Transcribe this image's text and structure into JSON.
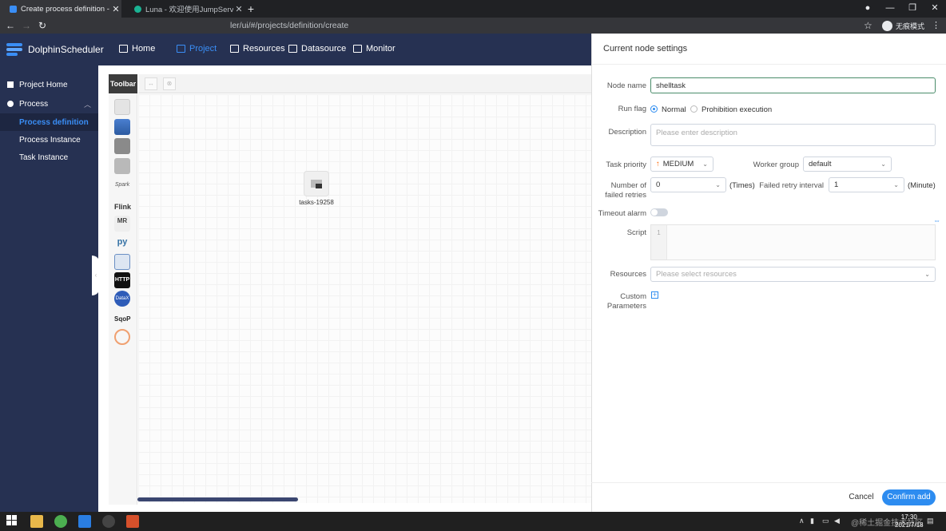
{
  "browser": {
    "tabs": [
      {
        "title": "Create process definition - Do",
        "active": true
      },
      {
        "title": "Luna - 欢迎使用JumpServer开源",
        "active": false
      }
    ],
    "url": "ler/ui/#/projects/definition/create",
    "profile": "无痕模式"
  },
  "app": {
    "brand": "DolphinScheduler",
    "nav": [
      {
        "label": "Home",
        "icon": "home-icon"
      },
      {
        "label": "Project",
        "icon": "project-icon",
        "active": true
      },
      {
        "label": "Resources",
        "icon": "folder-icon"
      },
      {
        "label": "Datasource",
        "icon": "database-icon"
      },
      {
        "label": "Monitor",
        "icon": "monitor-icon"
      }
    ],
    "accent": "#3a8ef6",
    "header_bg": "#263152"
  },
  "sidebar": {
    "items": [
      {
        "label": "Project Home",
        "icon": "home-icon"
      },
      {
        "label": "Process",
        "icon": "gear-icon",
        "expandable": true
      },
      {
        "label": "Process definition",
        "active": true
      },
      {
        "label": "Process Instance"
      },
      {
        "label": "Task Instance"
      }
    ]
  },
  "canvas": {
    "toolbar_label": "Toolbar",
    "tools": [
      "shell-icon",
      "sub-process-icon",
      "procedure-icon",
      "sql-icon",
      "spark-icon",
      "flink-icon",
      "mr-icon",
      "python-icon",
      "dependent-icon",
      "http-icon",
      "datax-icon",
      "sqoop-icon",
      "conditions-icon"
    ],
    "flink_label": "Flink",
    "mr_label": "MR",
    "python_label": "py",
    "http_label": "HTTP",
    "datax_label": "DataX",
    "sqoop_label": "SqoP",
    "spark_label": "Spark",
    "node_label": "tasks-19258"
  },
  "drawer": {
    "title": "Current node settings",
    "node_name": {
      "label": "Node name",
      "value": "shelltask"
    },
    "run_flag": {
      "label": "Run flag",
      "options": [
        "Normal",
        "Prohibition execution"
      ],
      "selected": "Normal"
    },
    "description": {
      "label": "Description",
      "placeholder": "Please enter description"
    },
    "task_priority": {
      "label": "Task priority",
      "value": "MEDIUM"
    },
    "worker_group": {
      "label": "Worker group",
      "value": "default"
    },
    "failed_retries": {
      "label": "Number of failed retries",
      "value": "0",
      "unit": "(Times)"
    },
    "retry_interval": {
      "label": "Failed retry interval",
      "value": "1",
      "unit": "(Minute)"
    },
    "timeout_alarm": {
      "label": "Timeout alarm",
      "enabled": false
    },
    "script": {
      "label": "Script",
      "line": "1"
    },
    "resources": {
      "label": "Resources",
      "placeholder": "Please select resources"
    },
    "custom_params": {
      "label": "Custom Parameters"
    },
    "cancel_label": "Cancel",
    "confirm_label": "Confirm add"
  },
  "taskbar": {
    "time": "17:30",
    "date": "2021/7/18",
    "watermark": "@稀土掘金技术社区"
  }
}
